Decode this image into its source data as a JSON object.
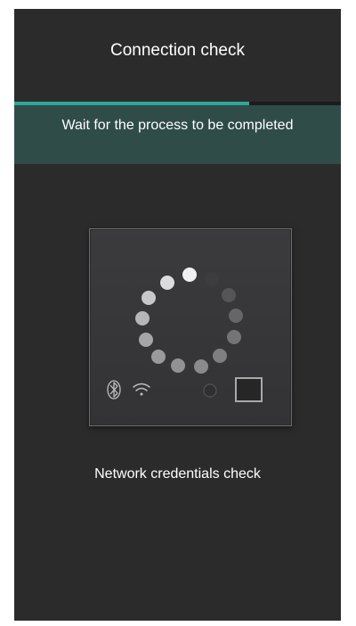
{
  "header": {
    "title": "Connection check"
  },
  "progress": {
    "value": 0.72,
    "accent": "#2fa79a"
  },
  "banner": {
    "message": "Wait for the process to be completed",
    "color": "#2f4c48"
  },
  "device": {
    "icons": [
      "bluetooth-icon",
      "wifi-icon",
      "status-led-icon",
      "square-button-icon"
    ]
  },
  "status": {
    "text": "Network credentials check"
  }
}
